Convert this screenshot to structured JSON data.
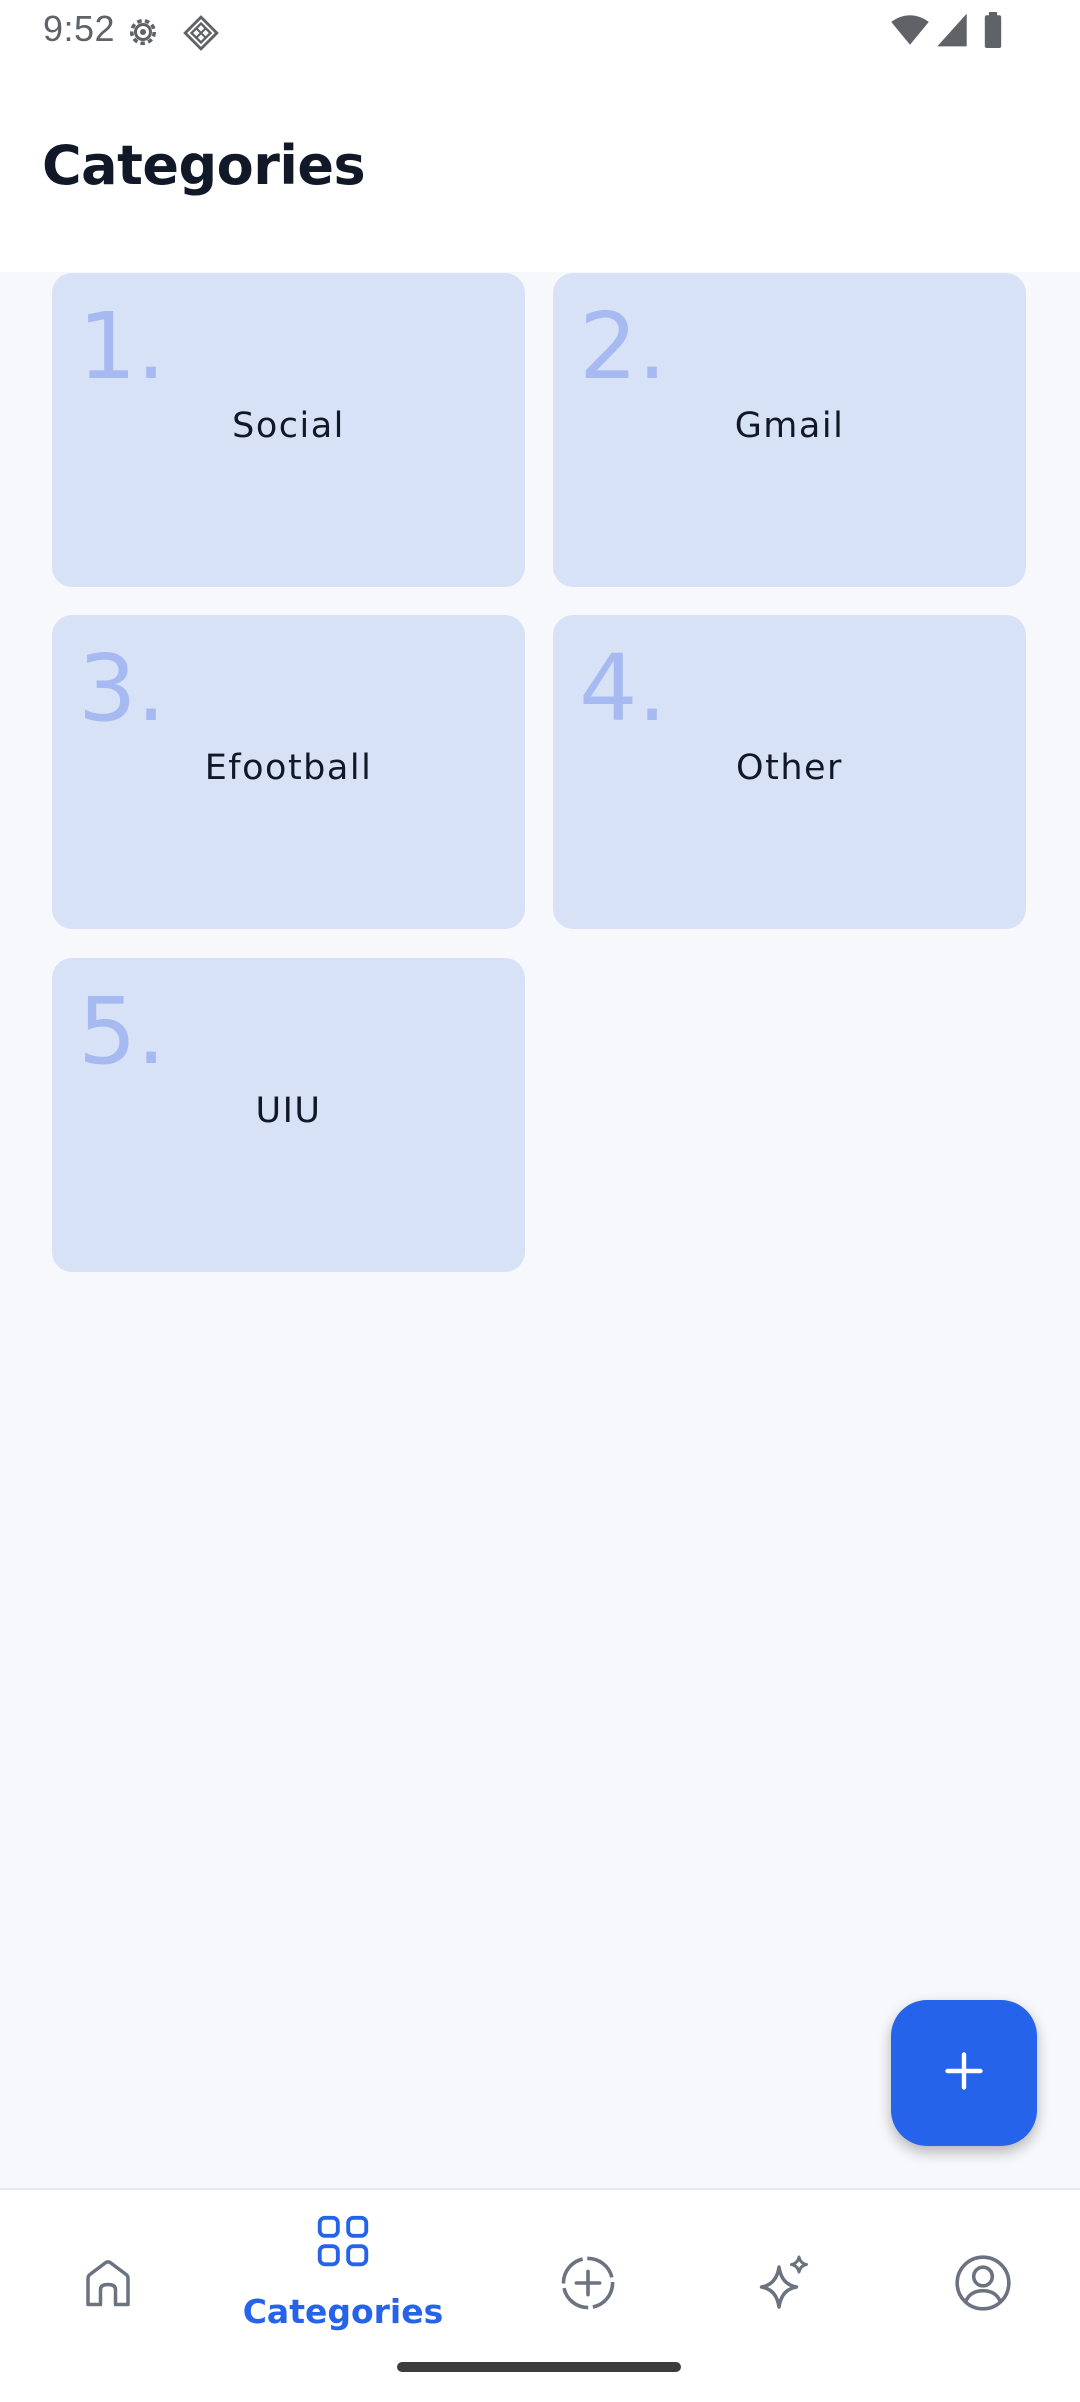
{
  "status_bar": {
    "time": "9:52",
    "icons": [
      "settings-gear-icon",
      "diamond-app-icon",
      "wifi-icon",
      "cellular-signal-icon",
      "battery-icon"
    ]
  },
  "header": {
    "title": "Categories"
  },
  "categories": [
    {
      "number": "1.",
      "name": "Social"
    },
    {
      "number": "2.",
      "name": "Gmail"
    },
    {
      "number": "3.",
      "name": "Efootball"
    },
    {
      "number": "4.",
      "name": "Other"
    },
    {
      "number": "5.",
      "name": "UIU"
    }
  ],
  "fab": {
    "icon": "plus-icon"
  },
  "bottom_nav": {
    "items": [
      {
        "icon": "home-icon",
        "label": ""
      },
      {
        "icon": "categories-grid-icon",
        "label": "Categories",
        "active": true
      },
      {
        "icon": "add-circle-icon",
        "label": ""
      },
      {
        "icon": "sparkle-icon",
        "label": ""
      },
      {
        "icon": "profile-icon",
        "label": ""
      }
    ]
  },
  "colors": {
    "accent": "#2563eb",
    "card_background": "#d8e2f6",
    "card_number": "#a6baf1",
    "page_background": "#f7f8fb",
    "title_text": "#111827",
    "inactive_icon": "#6b7280"
  }
}
